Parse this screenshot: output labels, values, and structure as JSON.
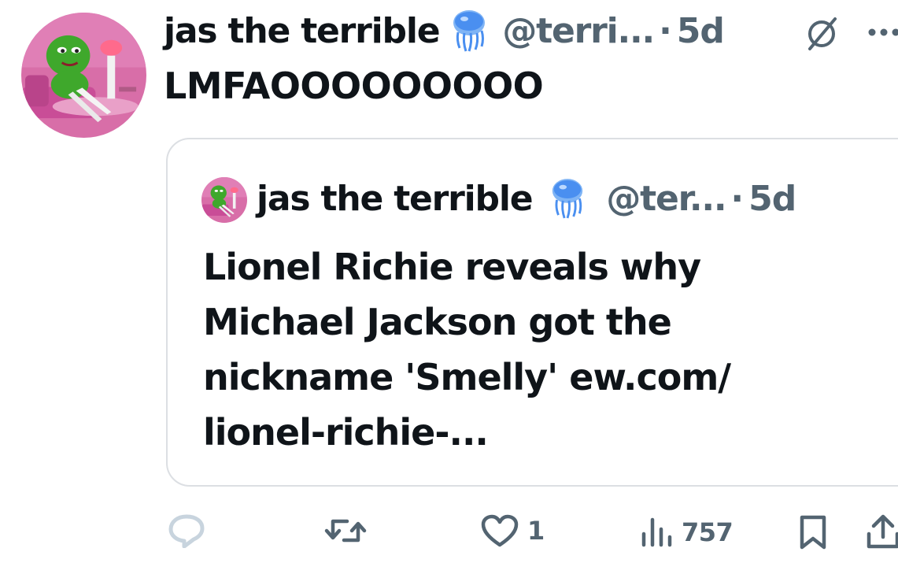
{
  "tweet": {
    "author": {
      "display_name": "jas the terrible",
      "handle": "@terri...",
      "badge_icon": "jellyfish-icon"
    },
    "separator": "·",
    "time": "5d",
    "text": "LMFAOOOOOOOOO"
  },
  "quote": {
    "author": {
      "display_name": "jas the terrible",
      "handle": "@ter...",
      "badge_icon": "jellyfish-icon"
    },
    "separator": "·",
    "time": "5d",
    "text_lines": [
      "Lionel Richie reveals why",
      "Michael Jackson got the",
      "nickname 'Smelly' ew.com/",
      "lionel-richie-..."
    ]
  },
  "actions": {
    "reply_count": "",
    "retweet_count": "",
    "like_count": "1",
    "views_count": "757"
  },
  "colors": {
    "text": "#0f1419",
    "secondary": "#536471",
    "border": "#dcdfe3",
    "reply_icon": "#c8d4de",
    "badge": "#4a8ff0"
  }
}
